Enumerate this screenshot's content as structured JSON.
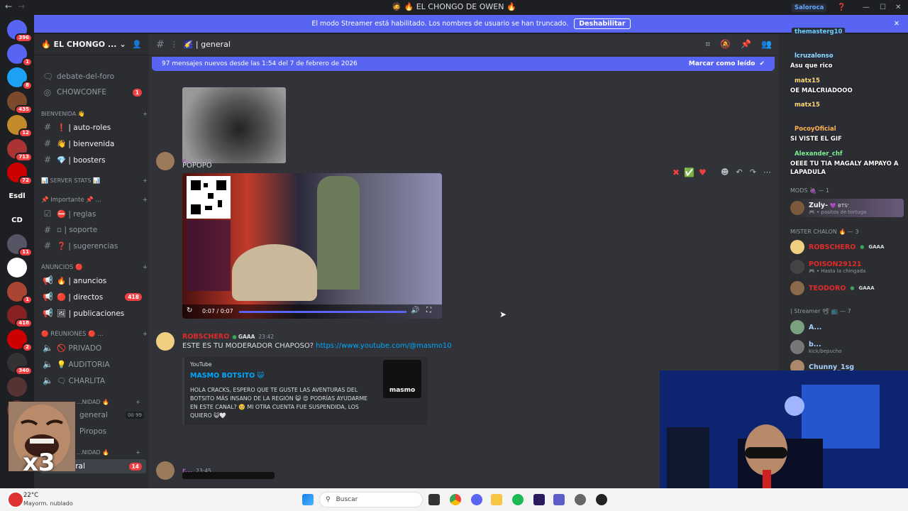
{
  "window": {
    "title": "🧔 🔥 EL CHONGO DE OWEN 🔥"
  },
  "banner": {
    "text": "El modo Streamer está habilitado. Los nombres de usuario se han truncado.",
    "button": "Deshabilitar"
  },
  "server": {
    "name": "🔥 EL CHONGO ..."
  },
  "guilds": [
    {
      "badge": "396",
      "color": "#5865f2"
    },
    {
      "badge": "1",
      "color": "#5865f2"
    },
    {
      "badge": "8",
      "color": "#1da1f2"
    },
    {
      "badge": "435",
      "color": "#7a4a2a"
    },
    {
      "badge": "12",
      "color": "#c48a2a"
    },
    {
      "badge": "713",
      "color": "#a33"
    },
    {
      "badge": "72",
      "color": "#c00"
    },
    {
      "label": "Esdl",
      "color": "#1e1f22"
    },
    {
      "label": "CD",
      "color": "#1e1f22"
    },
    {
      "badge": "11",
      "color": "#556"
    },
    {
      "badge": "",
      "color": "#fff"
    },
    {
      "badge": "1",
      "color": "#a43"
    },
    {
      "badge": "418",
      "color": "#822"
    },
    {
      "badge": "2",
      "color": "#c00"
    },
    {
      "badge": "340",
      "color": "#333"
    },
    {
      "badge": "",
      "color": "#533"
    },
    {
      "badge": "1",
      "color": "#633"
    }
  ],
  "sidebar": {
    "channels_top": [
      {
        "name": "debate-del-foro",
        "icon": "#"
      },
      {
        "name": "CHOWCONFE",
        "icon": "◎",
        "badge": "1"
      }
    ],
    "cat_bienvenida": "BIENVENIDA 👋",
    "bienvenida": [
      {
        "name": "❗ | auto-roles"
      },
      {
        "name": "👋 | bienvenida"
      },
      {
        "name": "💎 | boosters"
      }
    ],
    "cat_server_stats": "📊 SERVER STATS 📊",
    "cat_importante": "📌 Importante 📌 ...",
    "importante": [
      {
        "name": "⛔ | reglas",
        "icon": "☑"
      },
      {
        "name": "▫ | soporte",
        "icon": "#"
      },
      {
        "name": "❓ | sugerencias",
        "icon": "#"
      }
    ],
    "cat_anuncios": "ANUNCIOS 🔴",
    "anuncios": [
      {
        "name": "🔥 | anuncios"
      },
      {
        "name": "🔴 | directos",
        "badge": "418"
      },
      {
        "name": "🖼 | publicaciones"
      }
    ],
    "cat_reuniones": "🔴 REUNIONES 🔴 ...",
    "reuniones": [
      {
        "name": "🚫 PRIVADO"
      },
      {
        "name": "💡 AUDITORIA"
      },
      {
        "name": "🗨 CHARLITA"
      }
    ],
    "cat_comunidad": "...NIDAD 🔥",
    "comunidad": [
      {
        "name": "general",
        "count": "00 99"
      },
      {
        "name": "Piropos"
      }
    ],
    "cat_comunidad2": "...NIDAD 🔥",
    "active_channel": {
      "name": "general",
      "badge": "14"
    }
  },
  "chat": {
    "channel": "🌠 | general",
    "new_messages": "97 mensajes nuevos desde las 1:54 del 7 de febrero de 2026",
    "mark_read": "Marcar como leído",
    "messages": [
      {
        "user": "r...",
        "time": "23:39",
        "text": "POPOPO",
        "user_color": "#a259c4"
      },
      {
        "user": "ROBSCHERO",
        "badge": "GAAA",
        "time": "23:42",
        "text": "ESTE ES TU MODERADOR CHAPOSO?",
        "link": "https://www.youtube.com/@masmo10",
        "user_color": "#e02a2a"
      },
      {
        "user": "r...",
        "time": "23:45",
        "user_color": "#a259c4"
      }
    ],
    "video": {
      "time": "0:07 / 0:07",
      "progress": 1.0
    },
    "embed": {
      "provider": "YouTube",
      "title": "MASMO BOTSITO 😺",
      "description": "HOLA CRACKS, ESPERO QUE TE GUSTE LAS AVENTURAS DEL BOTSITO MÁS INSANO DE LA REGIÓN 😺 😍 PODRÍAS AYUDARME EN ESTE CANAL? 🥺 MI OTRA CUENTA FUE SUSPENDIDA, LOS QUIERO 😺🤍",
      "thumb_label": "masmo"
    }
  },
  "members": {
    "cat_mods": "MODS 🍇 — 1",
    "mods": [
      {
        "name": "Zuly-",
        "tag": "💜 BTS'",
        "status": "🎮 • pasitos de tortuga",
        "color": "#f2f3f5"
      }
    ],
    "cat_mister": "MISTER CHALON 🔥 — 3",
    "mister": [
      {
        "name": "ROBSCHERO",
        "tag": "GAAA",
        "color": "#e02a2a"
      },
      {
        "name": "POISON29121",
        "status": "🎮 • Hasta la chingada",
        "color": "#e02a2a"
      },
      {
        "name": "TEODORO",
        "tag": "GAAA",
        "color": "#e02a2a"
      }
    ],
    "cat_streamer": "| Streamer 📽 📺 — 7",
    "streamers": [
      {
        "name": "A...",
        "color": "#a8d0ff"
      },
      {
        "name": "b...",
        "status": "kick/bepucho",
        "color": "#a8d0ff"
      },
      {
        "name": "Chunny_1sg",
        "color": "#a8d0ff"
      }
    ]
  },
  "stream_chat": [
    {
      "user": "Saloroca",
      "text": "",
      "user_color": "#5fa8ff"
    },
    {
      "user": "themasterg10",
      "text": "",
      "user_color": "#6ad1ff"
    },
    {
      "user": "lcruzalonso",
      "text": "Asu que rico",
      "user_color": "#8fdcff"
    },
    {
      "user": "matx15",
      "text": "OE MALCRIADOOO",
      "user_color": "#ffd86b"
    },
    {
      "user": "matx15",
      "text": "",
      "user_color": "#ffd86b"
    },
    {
      "user": "PocoyOficial",
      "text": "SI VISTE EL GIF",
      "user_color": "#ffb347"
    },
    {
      "user": "Alexander_chf",
      "text": "OEEE TU TIA MAGALY AMPAYO A LAPADULA",
      "user_color": "#7cf08a"
    }
  ],
  "overlay": {
    "x3": "x3"
  },
  "taskbar": {
    "weather_temp": "22°C",
    "weather_desc": "Mayorm. nublado",
    "search": "Buscar"
  },
  "colors": {
    "blurple": "#5865f2",
    "red": "#f23f43",
    "bg": "#313338",
    "sidebar": "#2b2d31"
  }
}
